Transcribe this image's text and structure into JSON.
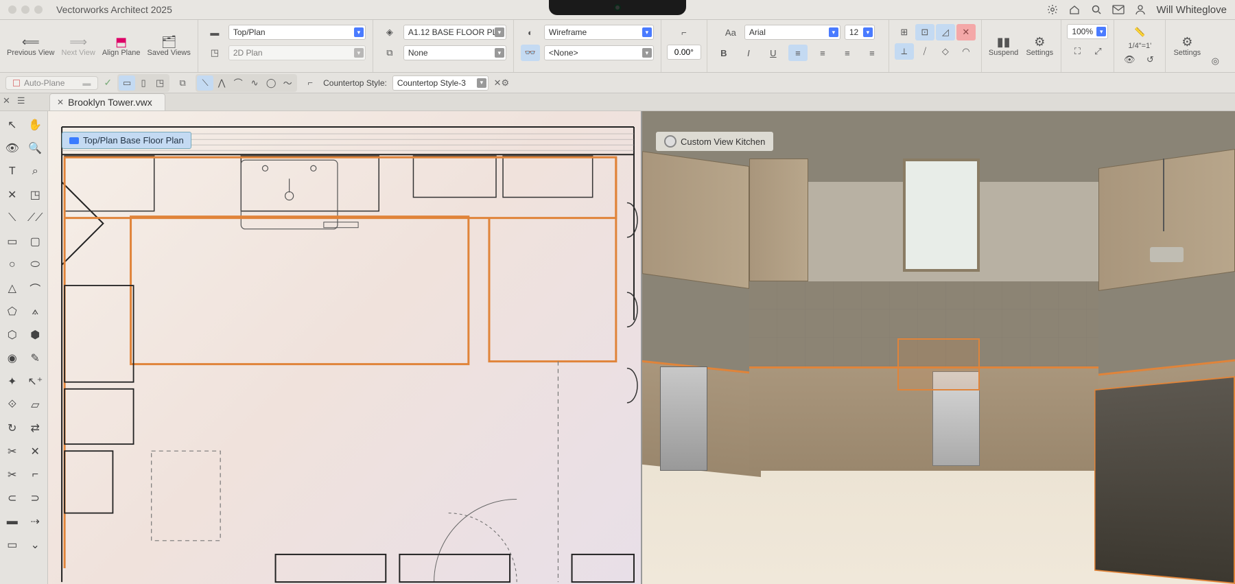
{
  "app": {
    "title": "Vectorworks Architect 2025"
  },
  "user": {
    "name": "Will Whiteglove"
  },
  "toolbar": {
    "prev_view": "Previous View",
    "next_view": "Next View",
    "align_plane": "Align Plane",
    "saved_views": "Saved Views",
    "view_mode": "Top/Plan",
    "render_mode_2d": "2D Plan",
    "layer_sel": "A1.12 BASE FLOOR PL",
    "render_style": "Wireframe",
    "class_none": "None",
    "class_none2": "<None>",
    "rotation": "0.00°",
    "font_family": "Arial",
    "font_size": "12",
    "suspend": "Suspend",
    "settings_label": "Settings",
    "zoom": "100%",
    "scale": "1/4\"=1'",
    "settings_btn": "Settings"
  },
  "subbar": {
    "auto_plane": "Auto-Plane",
    "countertop_label": "Countertop Style:",
    "countertop_value": "Countertop Style-3"
  },
  "tab": {
    "filename": "Brooklyn Tower.vwx"
  },
  "viewport": {
    "left_label": "Top/Plan Base Floor Plan",
    "right_label": "Custom View Kitchen"
  },
  "titlebar_icons": [
    "gear-icon",
    "home-icon",
    "search-icon",
    "mail-icon",
    "user-icon"
  ]
}
